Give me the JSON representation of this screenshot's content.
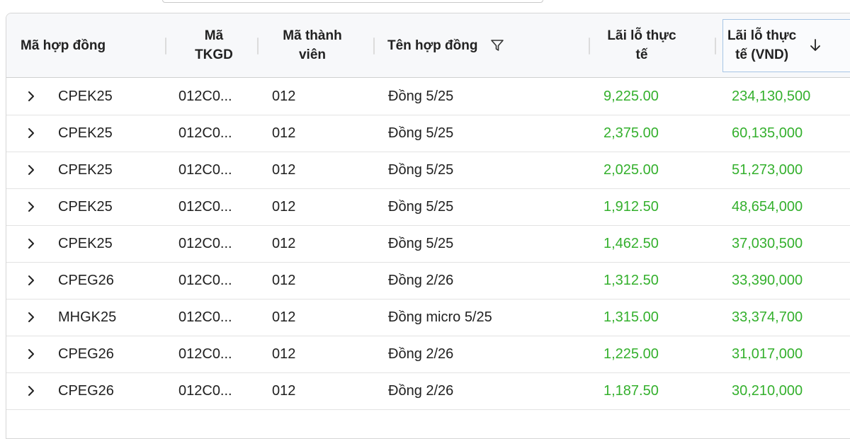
{
  "columns": {
    "contract_code": "Mã hợp đồng",
    "account": "Mã\nTKGD",
    "member": "Mã thành\nviên",
    "contract_name": "Tên hợp đồng",
    "pnl": "Lãi lỗ thực\ntế",
    "pnl_vnd": "Lãi lỗ thực\ntế (VND)"
  },
  "colors": {
    "positive": "#34b02d",
    "active_header_border": "#a7c6e6"
  },
  "icons": {
    "filter": "filter-icon",
    "sort": "arrow-down-icon",
    "expand": "chevron-right-icon"
  },
  "rows": [
    {
      "code": "CPEK25",
      "account": "012C0...",
      "member": "012",
      "name": "Đồng 5/25",
      "pnl": "9,225.00",
      "pnl_vnd": "234,130,500"
    },
    {
      "code": "CPEK25",
      "account": "012C0...",
      "member": "012",
      "name": "Đồng 5/25",
      "pnl": "2,375.00",
      "pnl_vnd": "60,135,000"
    },
    {
      "code": "CPEK25",
      "account": "012C0...",
      "member": "012",
      "name": "Đồng 5/25",
      "pnl": "2,025.00",
      "pnl_vnd": "51,273,000"
    },
    {
      "code": "CPEK25",
      "account": "012C0...",
      "member": "012",
      "name": "Đồng 5/25",
      "pnl": "1,912.50",
      "pnl_vnd": "48,654,000"
    },
    {
      "code": "CPEK25",
      "account": "012C0...",
      "member": "012",
      "name": "Đồng 5/25",
      "pnl": "1,462.50",
      "pnl_vnd": "37,030,500"
    },
    {
      "code": "CPEG26",
      "account": "012C0...",
      "member": "012",
      "name": "Đồng 2/26",
      "pnl": "1,312.50",
      "pnl_vnd": "33,390,000"
    },
    {
      "code": "MHGK25",
      "account": "012C0...",
      "member": "012",
      "name": "Đồng micro 5/25",
      "pnl": "1,315.00",
      "pnl_vnd": "33,374,700"
    },
    {
      "code": "CPEG26",
      "account": "012C0...",
      "member": "012",
      "name": "Đồng 2/26",
      "pnl": "1,225.00",
      "pnl_vnd": "31,017,000"
    },
    {
      "code": "CPEG26",
      "account": "012C0...",
      "member": "012",
      "name": "Đồng 2/26",
      "pnl": "1,187.50",
      "pnl_vnd": "30,210,000"
    }
  ]
}
